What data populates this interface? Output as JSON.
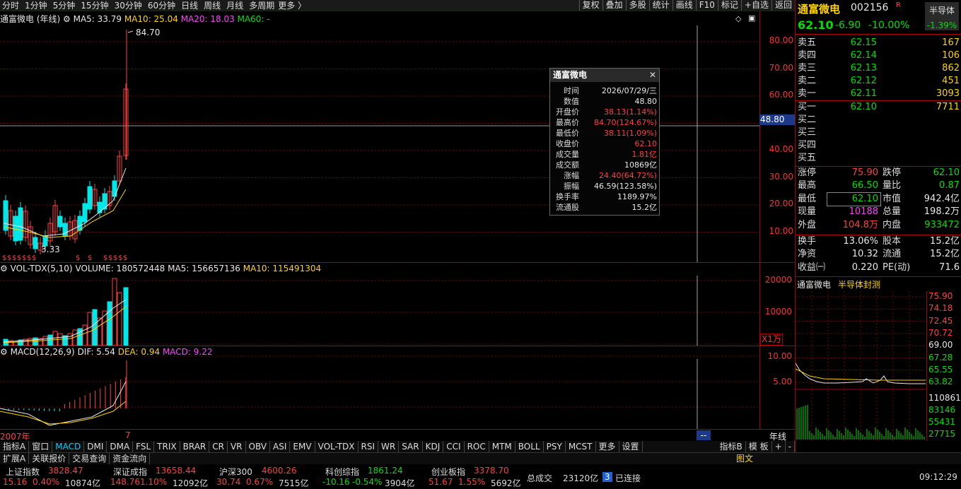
{
  "toolbar": {
    "periods": [
      "分时",
      "1分钟",
      "5分钟",
      "15分钟",
      "30分钟",
      "60分钟",
      "日线",
      "周线",
      "月线",
      "多周期"
    ],
    "more": "更多",
    "right_buttons": [
      "复权",
      "叠加",
      "多股",
      "统计",
      "画线",
      "F10",
      "标记",
      "+自选",
      "返回"
    ]
  },
  "main_header": {
    "name": "通富微电 (年线)",
    "ma5": "MA5: 33.79",
    "ma10": "MA10: 25.04",
    "ma20": "MA20: 18.03",
    "ma60": "MA60: -"
  },
  "price_axis": [
    "80.00",
    "70.00",
    "60.00",
    "50.00",
    "40.00",
    "30.00",
    "20.00",
    "10.00"
  ],
  "cursor_price": "48.80",
  "high_label": "84.70",
  "low_label": "3.33",
  "vol_header": {
    "name": "VOL-TDX(5,10)",
    "volume": "VOLUME: 180572448",
    "ma5": "MA5: 156657136",
    "ma10": "MA10: 115491304"
  },
  "vol_axis": [
    "20000",
    "10000"
  ],
  "vol_unit": "X1万",
  "macd_header": {
    "name": "MACD(12,26,9)",
    "dif": "DIF: 5.54",
    "dea": "DEA: 0.94",
    "macd": "MACD: 9.22"
  },
  "macd_axis": [
    "10.00",
    "5.00"
  ],
  "date_axis": {
    "start": "2007年",
    "tick": "7",
    "cursor": "--",
    "period": "年线"
  },
  "tooltip": {
    "title": "通富微电",
    "rows": [
      {
        "k": "时间",
        "v": "2026/07/29/三",
        "c": "#e8e8e8"
      },
      {
        "k": "数值",
        "v": "48.80",
        "c": "#e8e8e8"
      },
      {
        "k": "开盘价",
        "v": "38.13(1.14%)",
        "c": "#ff4040"
      },
      {
        "k": "最高价",
        "v": "84.70(124.67%)",
        "c": "#ff4040"
      },
      {
        "k": "最低价",
        "v": "38.11(1.09%)",
        "c": "#ff4040"
      },
      {
        "k": "收盘价",
        "v": "62.10",
        "c": "#ff4040"
      },
      {
        "k": "成交量",
        "v": "1.81亿",
        "c": "#ff4040"
      },
      {
        "k": "成交额",
        "v": "10869亿",
        "c": "#e8e8e8"
      },
      {
        "k": "涨幅",
        "v": "24.40(64.72%)",
        "c": "#ff4040"
      },
      {
        "k": "振幅",
        "v": "46.59(123.58%)",
        "c": "#e8e8e8"
      },
      {
        "k": "换手率",
        "v": "1189.97%",
        "c": "#e8e8e8"
      },
      {
        "k": "流通股",
        "v": "15.2亿",
        "c": "#e8e8e8"
      }
    ]
  },
  "quote": {
    "name": "通富微电",
    "code": "002156",
    "flag": "R",
    "sector": "半导体",
    "sector_chg": "-1.39%",
    "price": "62.10",
    "change": "-6.90",
    "pct": "-10.00%",
    "asks": [
      {
        "k": "卖五",
        "p": "62.15",
        "q": "167"
      },
      {
        "k": "卖四",
        "p": "62.14",
        "q": "106"
      },
      {
        "k": "卖三",
        "p": "62.13",
        "q": "862"
      },
      {
        "k": "卖二",
        "p": "62.12",
        "q": "451"
      },
      {
        "k": "卖一",
        "p": "62.11",
        "q": "3093"
      }
    ],
    "bids": [
      {
        "k": "买一",
        "p": "62.10",
        "q": "7711"
      },
      {
        "k": "买二",
        "p": "",
        "q": ""
      },
      {
        "k": "买三",
        "p": "",
        "q": ""
      },
      {
        "k": "买四",
        "p": "",
        "q": ""
      },
      {
        "k": "买五",
        "p": "",
        "q": ""
      }
    ],
    "stats1": [
      {
        "k1": "涨停",
        "v1": "75.90",
        "c1": "#ff4040",
        "k2": "跌停",
        "v2": "62.10",
        "c2": "#00e000"
      },
      {
        "k1": "最高",
        "v1": "66.50",
        "c1": "#00e000",
        "k2": "量比",
        "v2": "0.87",
        "c2": "#00e000"
      },
      {
        "k1": "最低",
        "v1": "62.10",
        "c1": "#00e000",
        "k2": "市值",
        "v2": "942.4亿",
        "c2": "#e8e8e8"
      },
      {
        "k1": "现量",
        "v1": "10188",
        "c1": "#ff40ff",
        "k2": "总量",
        "v2": "198.2万",
        "c2": "#e8e8e8"
      },
      {
        "k1": "外盘",
        "v1": "104.8万",
        "c1": "#ff4040",
        "k2": "内盘",
        "v2": "933472",
        "c2": "#00e000"
      }
    ],
    "stats2": [
      {
        "k1": "换手",
        "v1": "13.06%",
        "c1": "#e8e8e8",
        "k2": "股本",
        "v2": "15.2亿",
        "c2": "#e8e8e8"
      },
      {
        "k1": "净资",
        "v1": "10.32",
        "c1": "#e8e8e8",
        "k2": "流通",
        "v2": "15.2亿",
        "c2": "#e8e8e8"
      },
      {
        "k1": "收益㈠",
        "v1": "0.220",
        "c1": "#e8e8e8",
        "k2": "PE(动)",
        "v2": "71.6",
        "c2": "#e8e8e8"
      }
    ]
  },
  "mini": {
    "name": "通富微电",
    "tag": "半导体封测",
    "price_labels": [
      {
        "v": "75.90",
        "c": "#ff4040"
      },
      {
        "v": "74.18",
        "c": "#ff4040"
      },
      {
        "v": "72.45",
        "c": "#ff4040"
      },
      {
        "v": "70.72",
        "c": "#ff4040"
      },
      {
        "v": "69.00",
        "c": "#e8e8e8"
      },
      {
        "v": "67.28",
        "c": "#00e000"
      },
      {
        "v": "65.55",
        "c": "#00e000"
      },
      {
        "v": "63.82",
        "c": "#00e000"
      }
    ],
    "vol_labels": [
      "110861",
      "83146",
      "55431",
      "27715"
    ]
  },
  "indicator_tabs": [
    "指标A",
    "窗口",
    "MACD",
    "DMI",
    "DMA",
    "FSL",
    "TRIX",
    "BRAR",
    "CR",
    "VR",
    "OBV",
    "ASI",
    "EMV",
    "VOL-TDX",
    "RSI",
    "WR",
    "SAR",
    "KDJ",
    "CCI",
    "ROC",
    "MTM",
    "BOLL",
    "PSY",
    "MCST",
    "更多",
    "设置"
  ],
  "indicator_active": "MACD",
  "indicator_tail": [
    "指标B",
    "模 板",
    "+",
    "-"
  ],
  "ext_tabs": [
    "扩展A",
    "关联报价",
    "交易查询",
    "资金流向"
  ],
  "ext_right": "图文",
  "markets": [
    {
      "name": "上证指数",
      "value": "3828.47",
      "chg": "15.16",
      "pct": "0.40%",
      "amt": "10874亿",
      "c": "#ff4040"
    },
    {
      "name": "深证成指",
      "value": "13658.44",
      "chg": "148.76",
      "pct": "1.10%",
      "amt": "12092亿",
      "c": "#ff4040"
    },
    {
      "name": "沪深300",
      "value": "4600.26",
      "chg": "30.74",
      "pct": "0.67%",
      "amt": "7515亿",
      "c": "#ff4040"
    },
    {
      "name": "科创综指",
      "value": "1861.24",
      "chg": "-10.16",
      "pct": "-0.54%",
      "amt": "3904亿",
      "c": "#00e000"
    },
    {
      "name": "创业板指",
      "value": "3378.70",
      "chg": "51.67",
      "pct": "1.55%",
      "amt": "5692亿",
      "c": "#ff4040"
    }
  ],
  "total": {
    "label": "总成交",
    "value": "23120亿"
  },
  "connection": {
    "badge": "3",
    "text": "已连接"
  },
  "clock": "09:12:29"
}
